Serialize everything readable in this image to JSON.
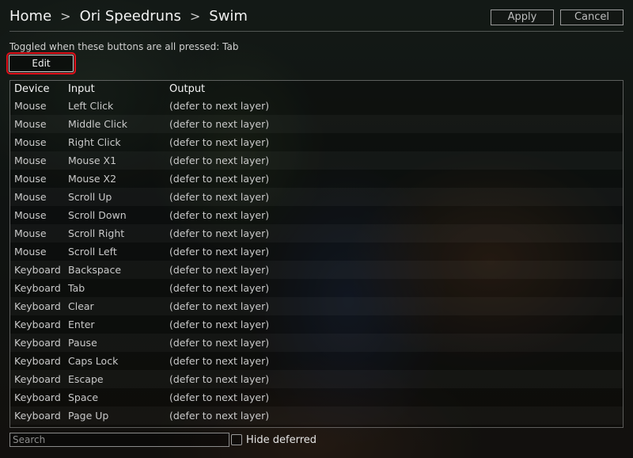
{
  "breadcrumb": {
    "items": [
      "Home",
      "Ori Speedruns",
      "Swim"
    ],
    "separator": ">"
  },
  "header": {
    "apply_label": "Apply",
    "cancel_label": "Cancel"
  },
  "toggle": {
    "info": "Toggled when these buttons are all pressed: Tab",
    "edit_label": "Edit"
  },
  "table": {
    "headers": {
      "device": "Device",
      "input": "Input",
      "output": "Output"
    },
    "rows": [
      {
        "device": "Mouse",
        "input": "Left Click",
        "output": "(defer to next layer)"
      },
      {
        "device": "Mouse",
        "input": "Middle Click",
        "output": "(defer to next layer)"
      },
      {
        "device": "Mouse",
        "input": "Right Click",
        "output": "(defer to next layer)"
      },
      {
        "device": "Mouse",
        "input": "Mouse X1",
        "output": "(defer to next layer)"
      },
      {
        "device": "Mouse",
        "input": "Mouse X2",
        "output": "(defer to next layer)"
      },
      {
        "device": "Mouse",
        "input": "Scroll Up",
        "output": "(defer to next layer)"
      },
      {
        "device": "Mouse",
        "input": "Scroll Down",
        "output": "(defer to next layer)"
      },
      {
        "device": "Mouse",
        "input": "Scroll Right",
        "output": "(defer to next layer)"
      },
      {
        "device": "Mouse",
        "input": "Scroll Left",
        "output": "(defer to next layer)"
      },
      {
        "device": "Keyboard",
        "input": "Backspace",
        "output": "(defer to next layer)"
      },
      {
        "device": "Keyboard",
        "input": "Tab",
        "output": "(defer to next layer)"
      },
      {
        "device": "Keyboard",
        "input": "Clear",
        "output": "(defer to next layer)"
      },
      {
        "device": "Keyboard",
        "input": "Enter",
        "output": "(defer to next layer)"
      },
      {
        "device": "Keyboard",
        "input": "Pause",
        "output": "(defer to next layer)"
      },
      {
        "device": "Keyboard",
        "input": "Caps Lock",
        "output": "(defer to next layer)"
      },
      {
        "device": "Keyboard",
        "input": "Escape",
        "output": "(defer to next layer)"
      },
      {
        "device": "Keyboard",
        "input": "Space",
        "output": "(defer to next layer)"
      },
      {
        "device": "Keyboard",
        "input": "Page Up",
        "output": "(defer to next layer)"
      }
    ]
  },
  "footer": {
    "search_placeholder": "Search",
    "search_value": "",
    "hide_deferred_label": "Hide deferred",
    "hide_deferred_checked": false
  },
  "colors": {
    "edit_highlight": "#e0101a",
    "text_primary": "#f2f2f2",
    "text_secondary": "#c9c9c9"
  }
}
